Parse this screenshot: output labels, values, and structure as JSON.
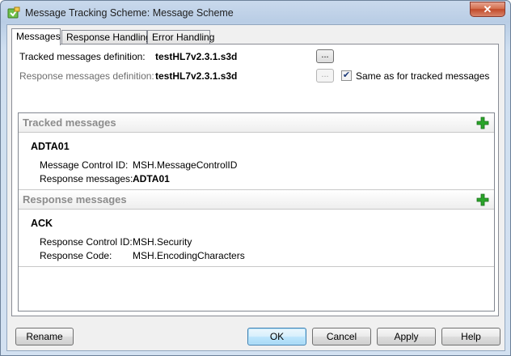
{
  "window": {
    "title": "Message Tracking Scheme: Message Scheme",
    "close_label": "✕"
  },
  "tabs": [
    {
      "label": "Messages",
      "active": true
    },
    {
      "label": "Response Handling",
      "active": false
    },
    {
      "label": "Error Handling",
      "active": false
    }
  ],
  "definitions": {
    "tracked_label": "Tracked messages definition:",
    "tracked_value": "testHL7v2.3.1.s3d",
    "response_label": "Response messages definition:",
    "response_value": "testHL7v2.3.1.s3d",
    "browse_label": "...",
    "same_as_label": "Same as for tracked messages",
    "same_as_checked": true
  },
  "tracked_section": {
    "title": "Tracked messages",
    "message": {
      "name": "ADTA01",
      "control_id_label": "Message Control ID:",
      "control_id_value": "MSH.MessageControlID",
      "response_label": "Response messages:",
      "response_value": "ADTA01"
    }
  },
  "response_section": {
    "title": "Response messages",
    "message": {
      "name": "ACK",
      "control_id_label": "Response Control ID:",
      "control_id_value": "MSH.Security",
      "code_label": "Response Code:",
      "code_value": "MSH.EncodingCharacters"
    }
  },
  "buttons": {
    "rename": "Rename",
    "ok": "OK",
    "cancel": "Cancel",
    "apply": "Apply",
    "help": "Help"
  },
  "colors": {
    "add_icon": "#2aa52a",
    "section_title": "#8c8c8c"
  }
}
